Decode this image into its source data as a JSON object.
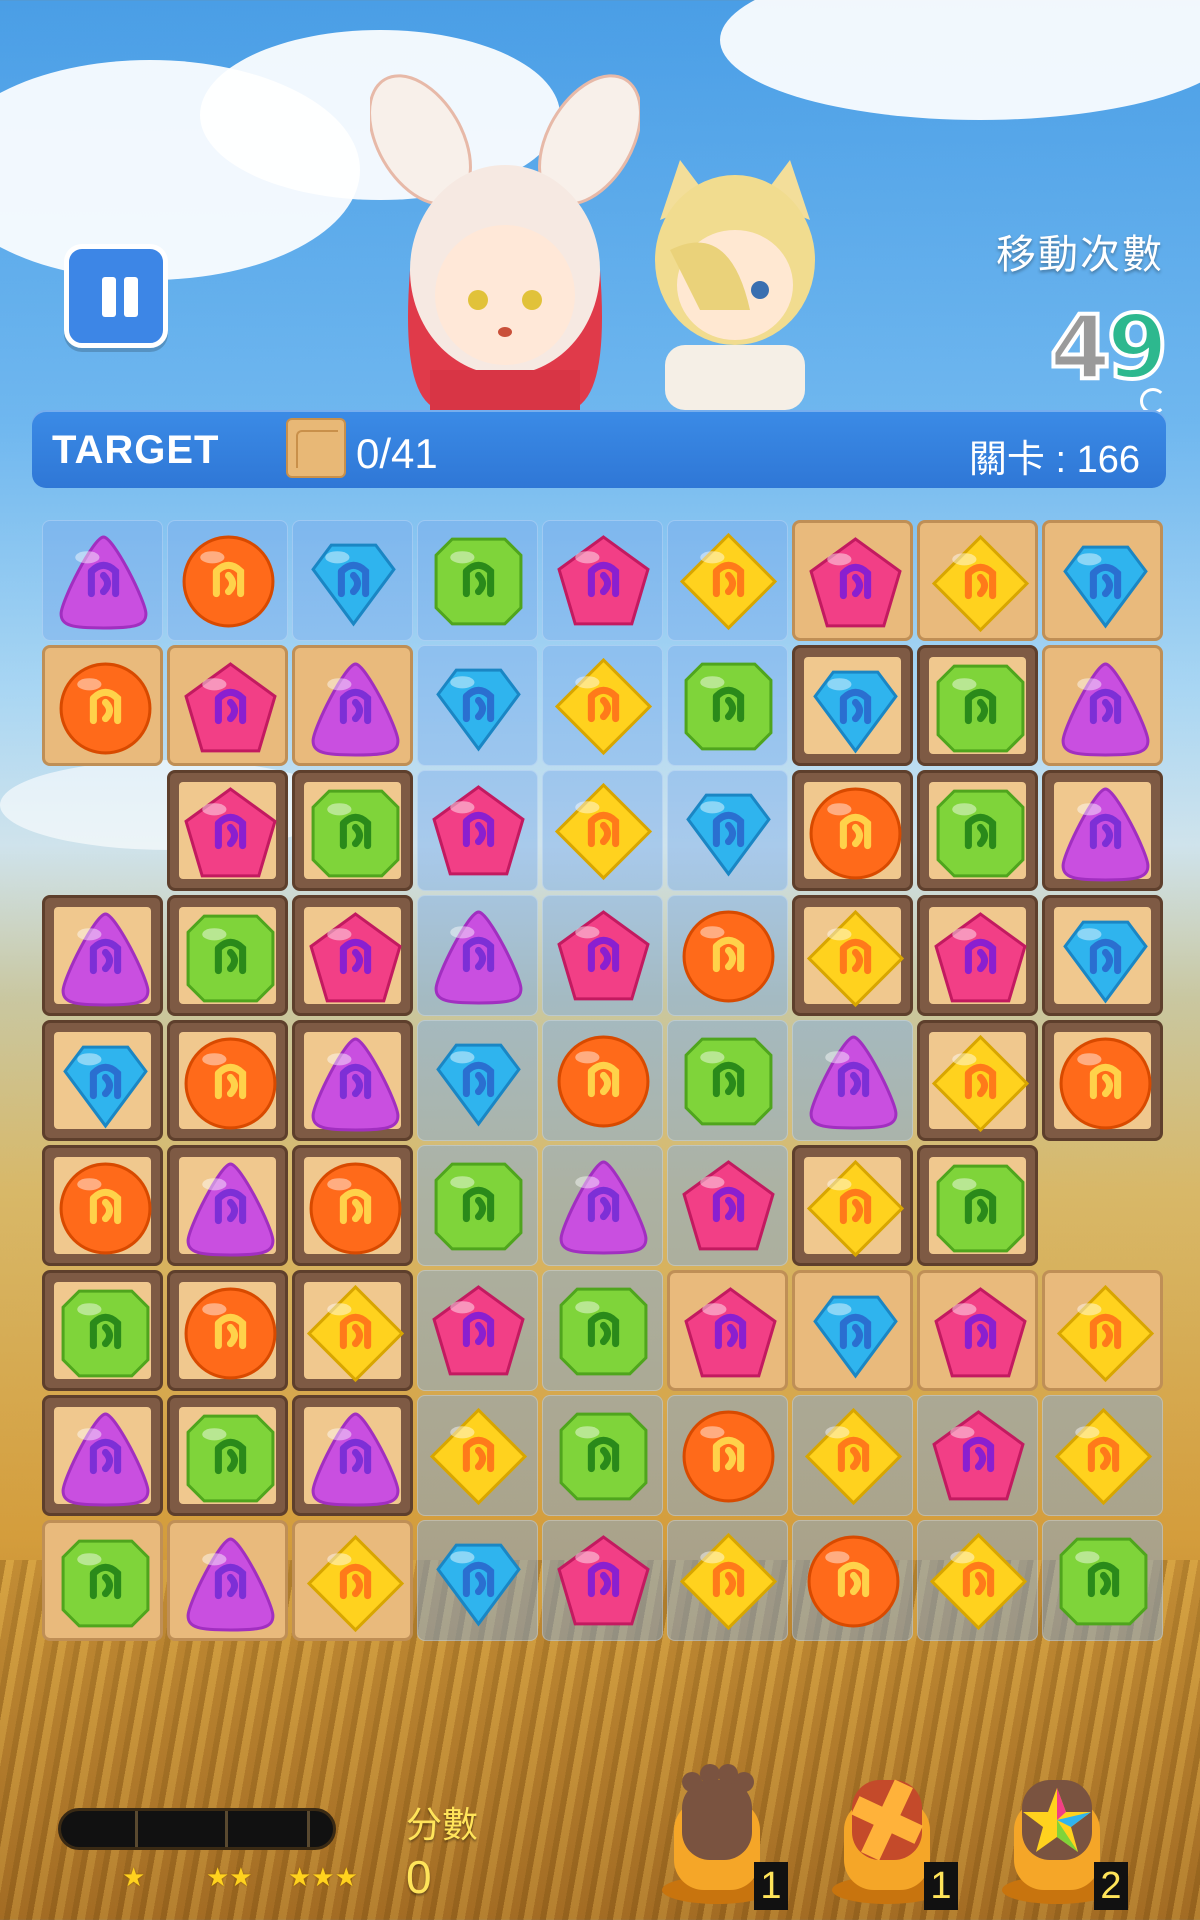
{
  "header": {
    "moves_label": "移動次數",
    "moves_digit_1": "4",
    "moves_digit_2": "9"
  },
  "target_bar": {
    "label": "TARGET",
    "progress": "0/41",
    "level": "關卡 : 166"
  },
  "board": {
    "columns": 9,
    "rows": 9,
    "gem_legend": {
      "P": "purple-triangle-gem",
      "O": "orange-round-gem",
      "B": "blue-diamond-gem",
      "G": "green-square-gem",
      "K": "pink-pentagon-gem",
      "Y": "yellow-rhombus-gem"
    },
    "tile_legend": {
      "d": "dirt-tile",
      "c": "clear-tile",
      "w": "wooden-box-tile",
      "x": "empty"
    },
    "tiles": [
      "ccccccddd",
      "dddcccwwd",
      "xwwcccwww",
      "wwwcccwww",
      "wwwccccww",
      "wwwcccwwx",
      "wwwccdddd",
      "wwwcccccc",
      "dddcccccc"
    ],
    "gems": [
      "POBGKYKYB",
      "OKPBYGBGP",
      "-KGKYBOGP",
      "PGKPKOYKB",
      "BOPBOGPYO",
      "OPOGPKYG-",
      "GOYKGKBKY",
      "PGPYGOYKY",
      "GPYBKYOYG"
    ]
  },
  "colors": {
    "purple": "#c94fe0",
    "orange": "#ff6a1a",
    "blue": "#2fb4ee",
    "green": "#7fd43a",
    "pink": "#f23f86",
    "yellow": "#ffd21e"
  },
  "footer": {
    "star_marks": [
      "★",
      "★★",
      "★★★"
    ],
    "score_label": "分數",
    "score_value": "0",
    "boosters": [
      {
        "name": "paw-booster",
        "count": "1"
      },
      {
        "name": "cross-booster",
        "count": "1"
      },
      {
        "name": "rainbow-booster",
        "count": "2"
      }
    ]
  }
}
